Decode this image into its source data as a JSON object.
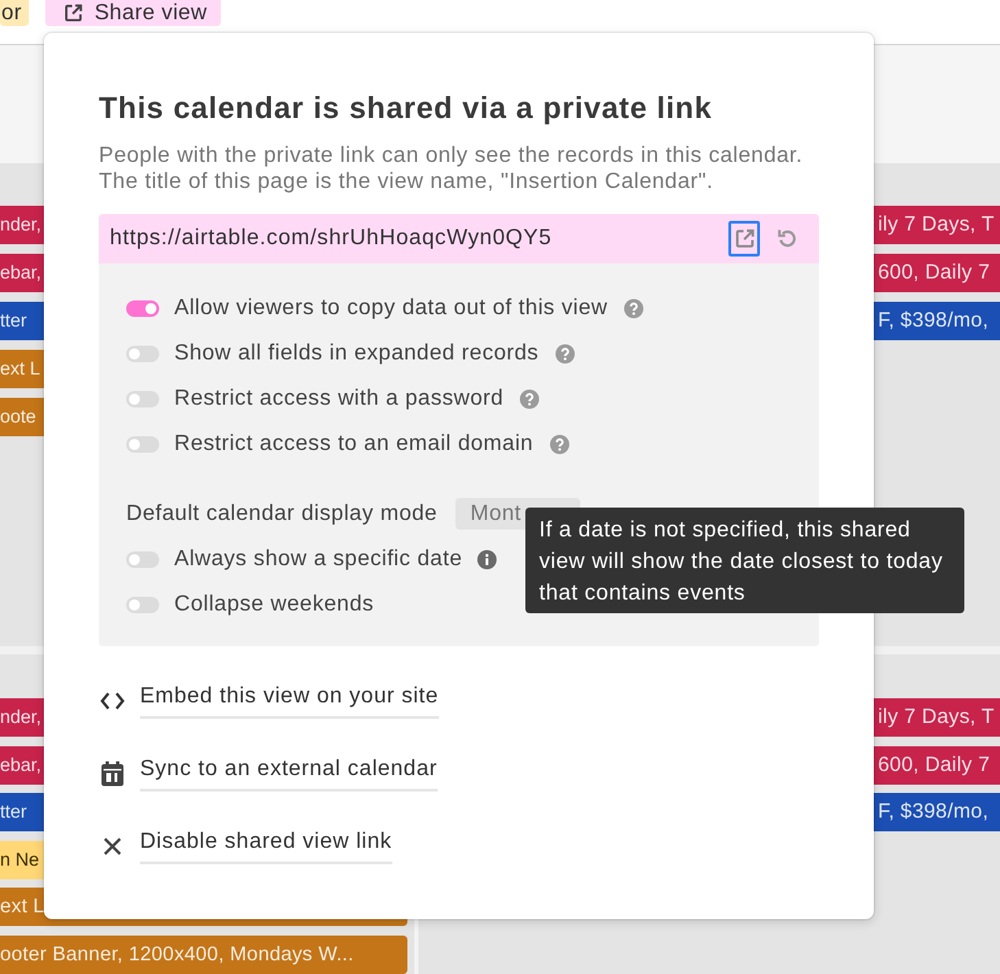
{
  "toolbar": {
    "buttons": [
      {
        "kind": "plain",
        "label": "or",
        "color": "#ffeab6"
      },
      {
        "kind": "share",
        "label": "Share view",
        "color": "#ffdaf6"
      }
    ]
  },
  "calendar": {
    "weeks": [
      {
        "left_events": [
          {
            "title": "nder,",
            "color": "#c8234b"
          },
          {
            "title": "ebar,",
            "color": "#c8234b"
          },
          {
            "title": "tter",
            "color": "#1b4fb3"
          },
          {
            "title": "ext L",
            "color": "#c47518"
          },
          {
            "title": "oote",
            "color": "#c47518"
          }
        ],
        "right_events": [
          {
            "title": "ily 7 Days, T",
            "color": "#c8234b"
          },
          {
            "title": "600, Daily 7",
            "color": "#c8234b"
          },
          {
            "title": "F, $398/mo,",
            "color": "#1b4fb3"
          }
        ]
      },
      {
        "left_events": [
          {
            "title": "nder,",
            "color": "#c8234b"
          },
          {
            "title": "ebar,",
            "color": "#c8234b"
          },
          {
            "title": "tter",
            "color": "#1b4fb3"
          },
          {
            "title": "n Ne",
            "color": "#ffd775"
          },
          {
            "title": "ext L",
            "color": "#c47518"
          },
          {
            "title": "ooter Banner, 1200x400, Mondays W...",
            "color": "#c47518"
          }
        ],
        "right_events": [
          {
            "title": "ily 7 Days, T",
            "color": "#c8234b"
          },
          {
            "title": "600, Daily 7",
            "color": "#c8234b"
          },
          {
            "title": "F, $398/mo,",
            "color": "#1b4fb3"
          }
        ]
      }
    ]
  },
  "share_dialog": {
    "title": "This calendar is shared via a private link",
    "description": [
      "People with the private link can only see the records in this calendar.",
      "The title of this page is the view name, \"Insertion Calendar\"."
    ],
    "link": {
      "url": "https://airtable.com/shrUhHoaqcWyn0QY5",
      "actions": [
        {
          "kind": "open",
          "focused": true
        },
        {
          "kind": "reset",
          "focused": false
        }
      ]
    },
    "options": [
      {
        "kind": "help",
        "label": "Allow viewers to copy data out of this view",
        "on": true
      },
      {
        "kind": "help",
        "label": "Show all fields in expanded records",
        "on": false
      },
      {
        "kind": "help",
        "label": "Restrict access with a password",
        "on": false
      },
      {
        "kind": "help",
        "label": "Restrict access to an email domain",
        "on": false
      }
    ],
    "display_mode": {
      "label": "Default calendar display mode",
      "value": "Mont"
    },
    "date_options": [
      {
        "kind": "info",
        "label": "Always show a specific date",
        "on": false
      },
      {
        "kind": "plain",
        "label": "Collapse weekends",
        "on": false
      }
    ],
    "links": [
      {
        "kind": "embed",
        "label": "Embed this view on your site"
      },
      {
        "kind": "sync",
        "label": "Sync to an external calendar"
      },
      {
        "kind": "disable",
        "label": "Disable shared view link"
      }
    ]
  },
  "tooltip": {
    "text": "If a date is not specified, this shared view will show the date closest to today that contains events"
  }
}
